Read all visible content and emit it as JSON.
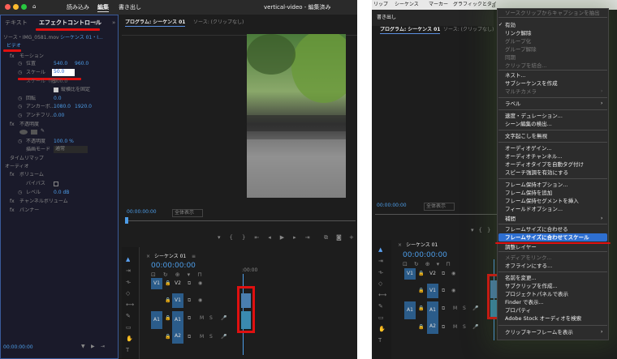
{
  "left": {
    "app_title": "vertical-video - 編集済み",
    "workspaces": [
      "読み込み",
      "編集",
      "書き出し"
    ],
    "active_workspace": "編集",
    "panel_tabs": [
      "テキスト",
      "エフェクトコントロール"
    ],
    "panel_menu": "≡",
    "panel_expand": "»",
    "source_selector": "ソース・IMG_0581.mov",
    "sequence_selector": "シーケンス 01・I...",
    "video_header": "ビデオ",
    "motion": "モーション",
    "position_label": "位置",
    "position_x": "540.0",
    "position_y": "960.0",
    "scale_label": "スケール",
    "scale_value": "50.0",
    "scale_width_label": "スケール（幅）",
    "scale_width_value": "100.0",
    "uniform_scale": "縦横比を固定",
    "rotation_label": "回転",
    "rotation_value": "0.0",
    "anchor_label": "アンカーポ...",
    "anchor_x": "1080.0",
    "anchor_y": "1920.0",
    "antiflicker_label": "アンチフリ...",
    "antiflicker_value": "0.00",
    "opacity": "不透明度",
    "opacity_label": "不透明度",
    "opacity_value": "100.0 %",
    "blend_label": "描画モード",
    "blend_value": "通常",
    "time_remap": "タイムリマップ",
    "audio_header": "オーディオ",
    "volume": "ボリューム",
    "bypass_label": "バイパス",
    "level_label": "レベル",
    "level_value": "0.0 dB",
    "channel_volume": "チャンネルボリューム",
    "panner": "パンナー",
    "timecode_bottom": "00:00:00:00",
    "program_tab": "プログラム: シーケンス 01",
    "source_tab": "ソース: (クリップなし)",
    "program_timecode": "00:00:00:00",
    "fit_label": "全体表示",
    "sequence_tab": "シーケンス 01",
    "seq_timecode": "00:00:00:00",
    "ruler_label": ":00:00",
    "tracks": [
      "V2",
      "V1",
      "A1",
      "A2"
    ]
  },
  "right": {
    "menubar": [
      "リップ",
      "シーケンス",
      "マーカー",
      "グラフィックとタイ"
    ],
    "workspace_export": "書き出し",
    "program_tab": "プログラム: シーケンス 01",
    "source_tab": "ソース: (クリップなし)",
    "program_timecode": "00:00:00:00",
    "fit_label": "全体表示",
    "sequence_tab": "シーケンス 01",
    "seq_timecode": "00:00:00:00",
    "tracks": [
      "V2",
      "V1",
      "A1",
      "A2"
    ],
    "menu_items": [
      {
        "label": "ソースクリップからキャプションを抽出",
        "disabled": true
      },
      {
        "label": "有効",
        "checked": true
      },
      {
        "label": "リンク解除"
      },
      {
        "label": "グループ化",
        "disabled": true
      },
      {
        "label": "グループ解除",
        "disabled": true
      },
      {
        "label": "同期",
        "disabled": true
      },
      {
        "label": "クリップを結合...",
        "disabled": true
      },
      {
        "label": "ネスト..."
      },
      {
        "label": "サブシーケンスを作成"
      },
      {
        "label": "マルチカメラ",
        "disabled": true,
        "submenu": true
      },
      {
        "label": "ラベル",
        "submenu": true
      },
      {
        "label": "速度・デュレーション..."
      },
      {
        "label": "シーン編集の検出..."
      },
      {
        "label": "文字起こしを無視"
      },
      {
        "label": "オーディオゲイン..."
      },
      {
        "label": "オーディオチャンネル..."
      },
      {
        "label": "オーディオタイプを自動タグ付け"
      },
      {
        "label": "スピーチ強調を有効にする"
      },
      {
        "label": "フレーム保持オプション..."
      },
      {
        "label": "フレーム保持を追加"
      },
      {
        "label": "フレーム保持セグメントを挿入"
      },
      {
        "label": "フィールドオプション..."
      },
      {
        "label": "補間",
        "submenu": true
      },
      {
        "label": "フレームサイズに合わせる"
      },
      {
        "label": "フレームサイズに合わせてスケール",
        "highlighted": true
      },
      {
        "label": "調整レイヤー"
      },
      {
        "label": "メディアをリンク...",
        "disabled": true
      },
      {
        "label": "オフラインにする..."
      },
      {
        "label": "名前を変更..."
      },
      {
        "label": "サブクリップを作成..."
      },
      {
        "label": "プロジェクトパネルで表示"
      },
      {
        "label": "Finder で表示..."
      },
      {
        "label": "プロパティ"
      },
      {
        "label": "Adobe Stock オーディオを検索"
      },
      {
        "label": "クリップキーフレームを表示",
        "submenu": true
      }
    ]
  },
  "colors": {
    "accent_blue": "#2e6fd1",
    "highlight_red": "#e01010",
    "timecode_blue": "#4d9de8"
  }
}
